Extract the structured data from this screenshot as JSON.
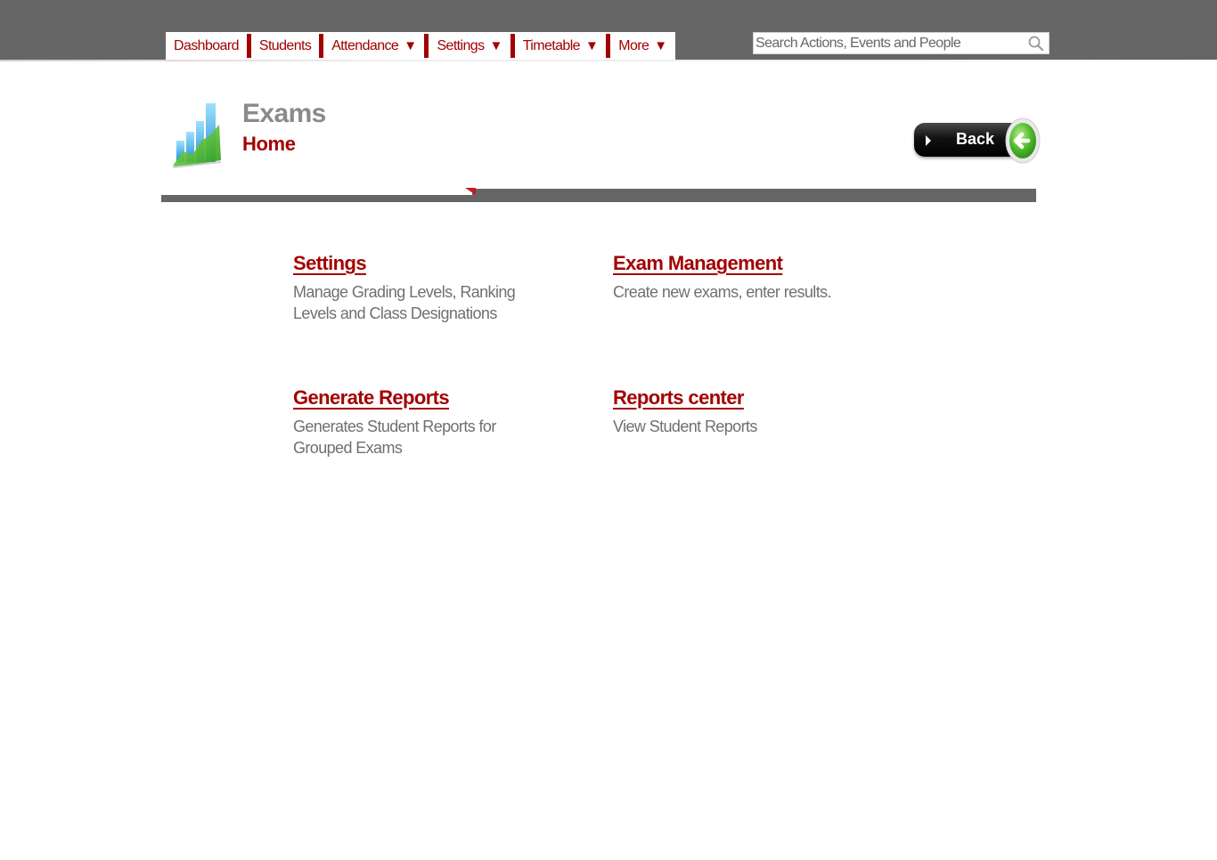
{
  "nav": {
    "items": [
      {
        "label": "Dashboard",
        "caret": ""
      },
      {
        "label": "Students",
        "caret": ""
      },
      {
        "label": "Attendance",
        "caret": "▼"
      },
      {
        "label": "Settings",
        "caret": "▼"
      },
      {
        "label": "Timetable",
        "caret": "▼"
      },
      {
        "label": "More",
        "caret": "▼"
      }
    ]
  },
  "search": {
    "placeholder": "Search Actions, Events and People",
    "value": ""
  },
  "header": {
    "title": "Exams",
    "subtitle": "Home",
    "back_label": "Back"
  },
  "cards": [
    {
      "title": "Settings",
      "description": "Manage Grading Levels, Ranking Levels and Class Designations"
    },
    {
      "title": "Exam Management",
      "description": "Create new exams, enter results."
    },
    {
      "title": "Generate Reports",
      "description": "Generates Student Reports for Grouped Exams"
    },
    {
      "title": "Reports center",
      "description": "View Student Reports"
    }
  ],
  "colors": {
    "brand_red": "#a30000",
    "bar_gray": "#666666",
    "text_gray": "#707070"
  },
  "icons": [
    "search-icon",
    "exams-chart-icon",
    "back-arrow-icon",
    "play-triangle-icon"
  ]
}
